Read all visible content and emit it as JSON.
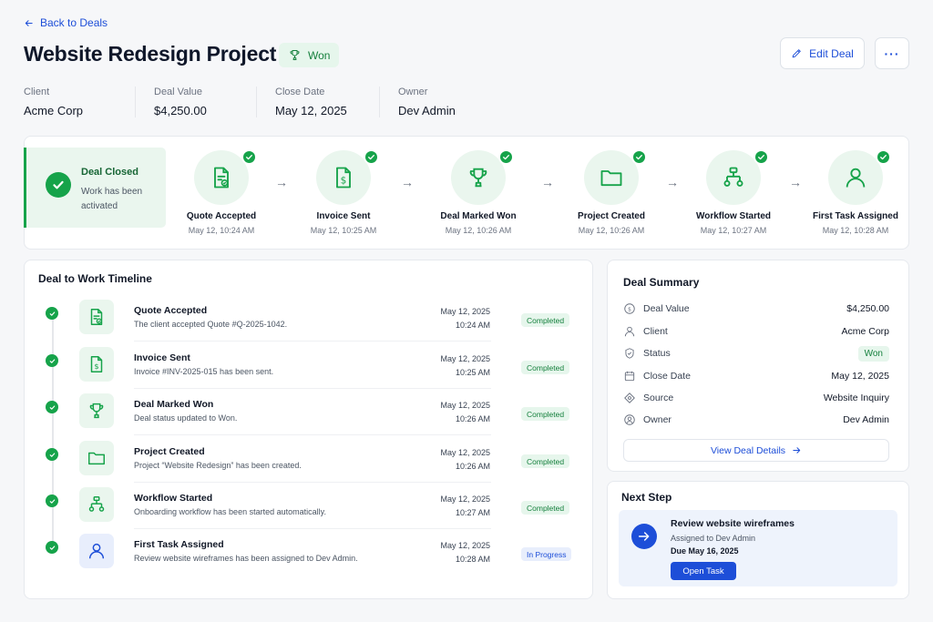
{
  "nav": {
    "back_label": "Back to Deals"
  },
  "header": {
    "title": "Website Redesign Project",
    "status_badge": "Won",
    "edit_label": "Edit Deal",
    "more_label": "···"
  },
  "meta": [
    {
      "label": "Client",
      "value": "Acme Corp"
    },
    {
      "label": "Deal Value",
      "value": "$4,250.00"
    },
    {
      "label": "Close Date",
      "value": "May 12, 2025"
    },
    {
      "label": "Owner",
      "value": "Dev Admin"
    }
  ],
  "pipeline": {
    "closed": {
      "title": "Deal Closed",
      "subtitle": "Work has been activated"
    },
    "arrow": "→",
    "steps": [
      {
        "name": "Quote Accepted",
        "time": "May 12, 10:24 AM",
        "icon": "document-check-icon"
      },
      {
        "name": "Invoice Sent",
        "time": "May 12, 10:25 AM",
        "icon": "invoice-dollar-icon"
      },
      {
        "name": "Deal Marked Won",
        "time": "May 12, 10:26 AM",
        "icon": "trophy-icon"
      },
      {
        "name": "Project Created",
        "time": "May 12, 10:26 AM",
        "icon": "folder-icon"
      },
      {
        "name": "Workflow Started",
        "time": "May 12, 10:27 AM",
        "icon": "workflow-icon"
      },
      {
        "name": "First Task Assigned",
        "time": "May 12, 10:28 AM",
        "icon": "user-icon"
      }
    ]
  },
  "timeline": {
    "title": "Deal to Work Timeline",
    "items": [
      {
        "name": "Quote Accepted",
        "desc": "The client accepted Quote #Q-2025-1042.",
        "date": "May 12, 2025",
        "time": "10:24 AM",
        "status": "Completed",
        "icon": "document-check-icon"
      },
      {
        "name": "Invoice Sent",
        "desc": "Invoice #INV-2025-015 has been sent.",
        "date": "May 12, 2025",
        "time": "10:25 AM",
        "status": "Completed",
        "icon": "invoice-dollar-icon"
      },
      {
        "name": "Deal Marked Won",
        "desc": "Deal status updated to Won.",
        "date": "May 12, 2025",
        "time": "10:26 AM",
        "status": "Completed",
        "icon": "trophy-icon"
      },
      {
        "name": "Project Created",
        "desc": "Project “Website Redesign” has been created.",
        "date": "May 12, 2025",
        "time": "10:26 AM",
        "status": "Completed",
        "icon": "folder-icon"
      },
      {
        "name": "Workflow Started",
        "desc": "Onboarding workflow has been started automatically.",
        "date": "May 12, 2025",
        "time": "10:27 AM",
        "status": "Completed",
        "icon": "workflow-icon"
      },
      {
        "name": "First Task Assigned",
        "desc": "Review website wireframes has been assigned to Dev Admin.",
        "date": "May 12, 2025",
        "time": "10:28 AM",
        "status": "In Progress",
        "icon": "user-icon"
      }
    ]
  },
  "summary": {
    "title": "Deal Summary",
    "rows": [
      {
        "label": "Deal Value",
        "value": "$4,250.00",
        "icon": "dollar-circle-icon"
      },
      {
        "label": "Client",
        "value": "Acme Corp",
        "icon": "user-icon"
      },
      {
        "label": "Status",
        "value": "Won",
        "icon": "shield-check-icon"
      },
      {
        "label": "Close Date",
        "value": "May 12, 2025",
        "icon": "calendar-icon"
      },
      {
        "label": "Source",
        "value": "Website Inquiry",
        "icon": "source-icon"
      },
      {
        "label": "Owner",
        "value": "Dev Admin",
        "icon": "user-circle-icon"
      }
    ],
    "view_label": "View Deal Details"
  },
  "next_step": {
    "title": "Next Step",
    "task": "Review website wireframes",
    "assigned": "Assigned to Dev Admin",
    "due": "Due May 16, 2025",
    "open_label": "Open Task"
  },
  "colors": {
    "brand": "#1d4ed8",
    "success": "#16a34a",
    "success_bg": "#eaf6ee"
  }
}
